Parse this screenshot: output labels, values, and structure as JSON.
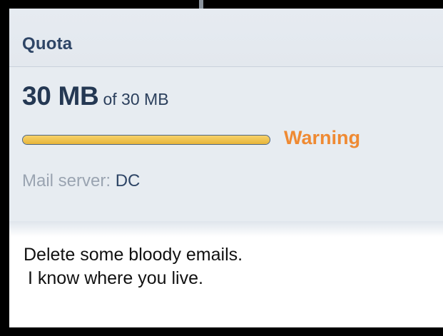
{
  "quota": {
    "title": "Quota",
    "used": "30 MB",
    "of_total": "of 30 MB",
    "usage_fraction": 1.0,
    "status": "Warning",
    "status_color": "#ef8a33",
    "bar_color": "#e7b53a",
    "server_label": "Mail server:",
    "server_value": "DC"
  },
  "message": {
    "line1": "Delete some bloody emails.",
    "line2": "I know where you live."
  }
}
